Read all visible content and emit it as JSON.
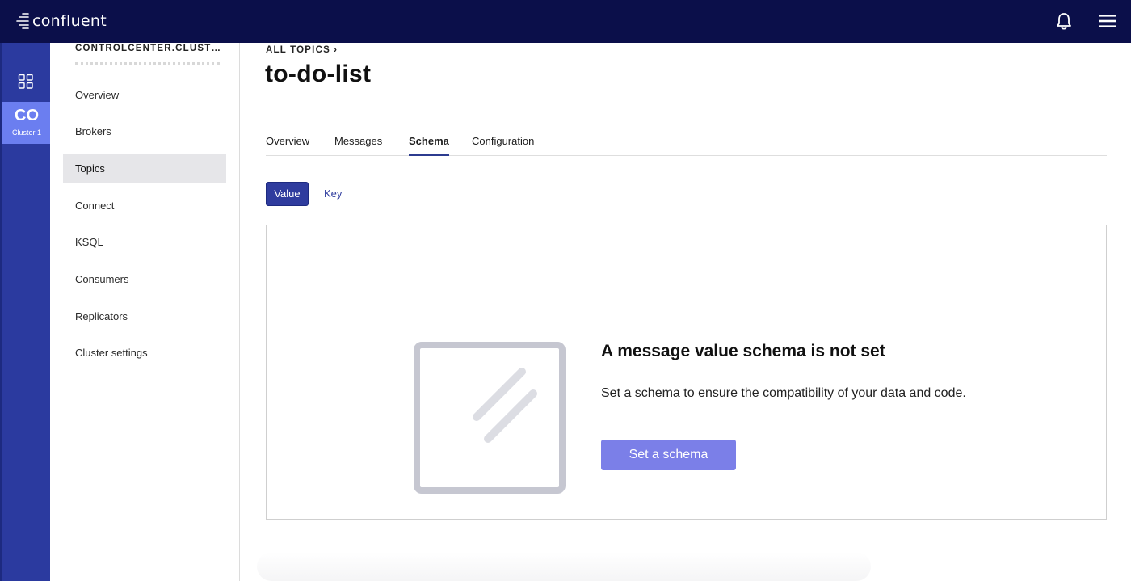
{
  "header": {
    "brand": "confluent",
    "notification_icon": "bell-icon",
    "menu_icon": "hamburger-menu-icon"
  },
  "rail": {
    "grid_icon": "grid-icon",
    "cluster": {
      "abbr": "CO",
      "label": "Cluster 1"
    }
  },
  "sidebar": {
    "cluster_name": "CONTROLCENTER.CLUST…",
    "items": [
      {
        "label": "Overview",
        "active": false
      },
      {
        "label": "Brokers",
        "active": false
      },
      {
        "label": "Topics",
        "active": true
      },
      {
        "label": "Connect",
        "active": false
      },
      {
        "label": "KSQL",
        "active": false
      },
      {
        "label": "Consumers",
        "active": false
      },
      {
        "label": "Replicators",
        "active": false
      },
      {
        "label": "Cluster settings",
        "active": false
      }
    ]
  },
  "main": {
    "breadcrumb": "ALL TOPICS",
    "title": "to-do-list",
    "tabs": [
      {
        "label": "Overview",
        "active": false
      },
      {
        "label": "Messages",
        "active": false
      },
      {
        "label": "Schema",
        "active": true
      },
      {
        "label": "Configuration",
        "active": false
      }
    ],
    "subtabs": {
      "value": "Value",
      "key": "Key",
      "selected": "Value"
    },
    "empty_state": {
      "heading": "A message value schema is not set",
      "text": "Set a schema to ensure the compatibility of your data and code.",
      "button": "Set a schema"
    }
  },
  "colors": {
    "topbar": "#0b0f4a",
    "rail": "#2b3a9f",
    "cluster_badge": "#6b7ef0",
    "primary_button": "#7b7fe8",
    "active_tab_underline": "#2c3b8f"
  }
}
